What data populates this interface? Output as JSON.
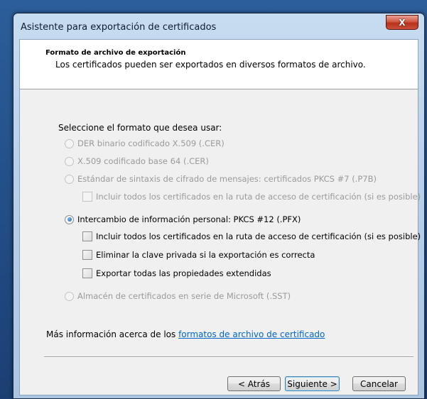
{
  "window": {
    "title": "Asistente para exportación de certificados",
    "close_label": "X"
  },
  "header": {
    "title": "Formato de archivo de exportación",
    "description": "Los certificados pueden ser exportados en diversos formatos de archivo."
  },
  "prompt": "Seleccione el formato que desea usar:",
  "options": [
    {
      "label": "DER binario codificado X.509 (.CER)",
      "enabled": false,
      "selected": false
    },
    {
      "label": "X.509 codificado base 64 (.CER)",
      "enabled": false,
      "selected": false
    },
    {
      "label": "Estándar de sintaxis de cifrado de mensajes: certificados PKCS #7 (.P7B)",
      "enabled": false,
      "selected": false
    },
    {
      "label": "Intercambio de información personal: PKCS #12 (.PFX)",
      "enabled": true,
      "selected": true
    },
    {
      "label": "Almacén de certificados en serie de Microsoft (.SST)",
      "enabled": false,
      "selected": false
    }
  ],
  "p7b_checkbox": {
    "label": "Incluir todos los certificados en la ruta de acceso de certificación (si es posible)",
    "checked": false,
    "enabled": false
  },
  "pfx_checkboxes": [
    {
      "label": "Incluir todos los certificados en la ruta de acceso de certificación (si es posible)",
      "checked": false
    },
    {
      "label": "Eliminar la clave privada si la exportación es correcta",
      "checked": false
    },
    {
      "label": "Exportar todas las propiedades extendidas",
      "checked": false
    }
  ],
  "more_info": {
    "text": "Más información acerca de los ",
    "link": "formatos de archivo de certificado"
  },
  "buttons": {
    "back": "< Atrás",
    "next": "Siguiente >",
    "cancel": "Cancelar"
  }
}
